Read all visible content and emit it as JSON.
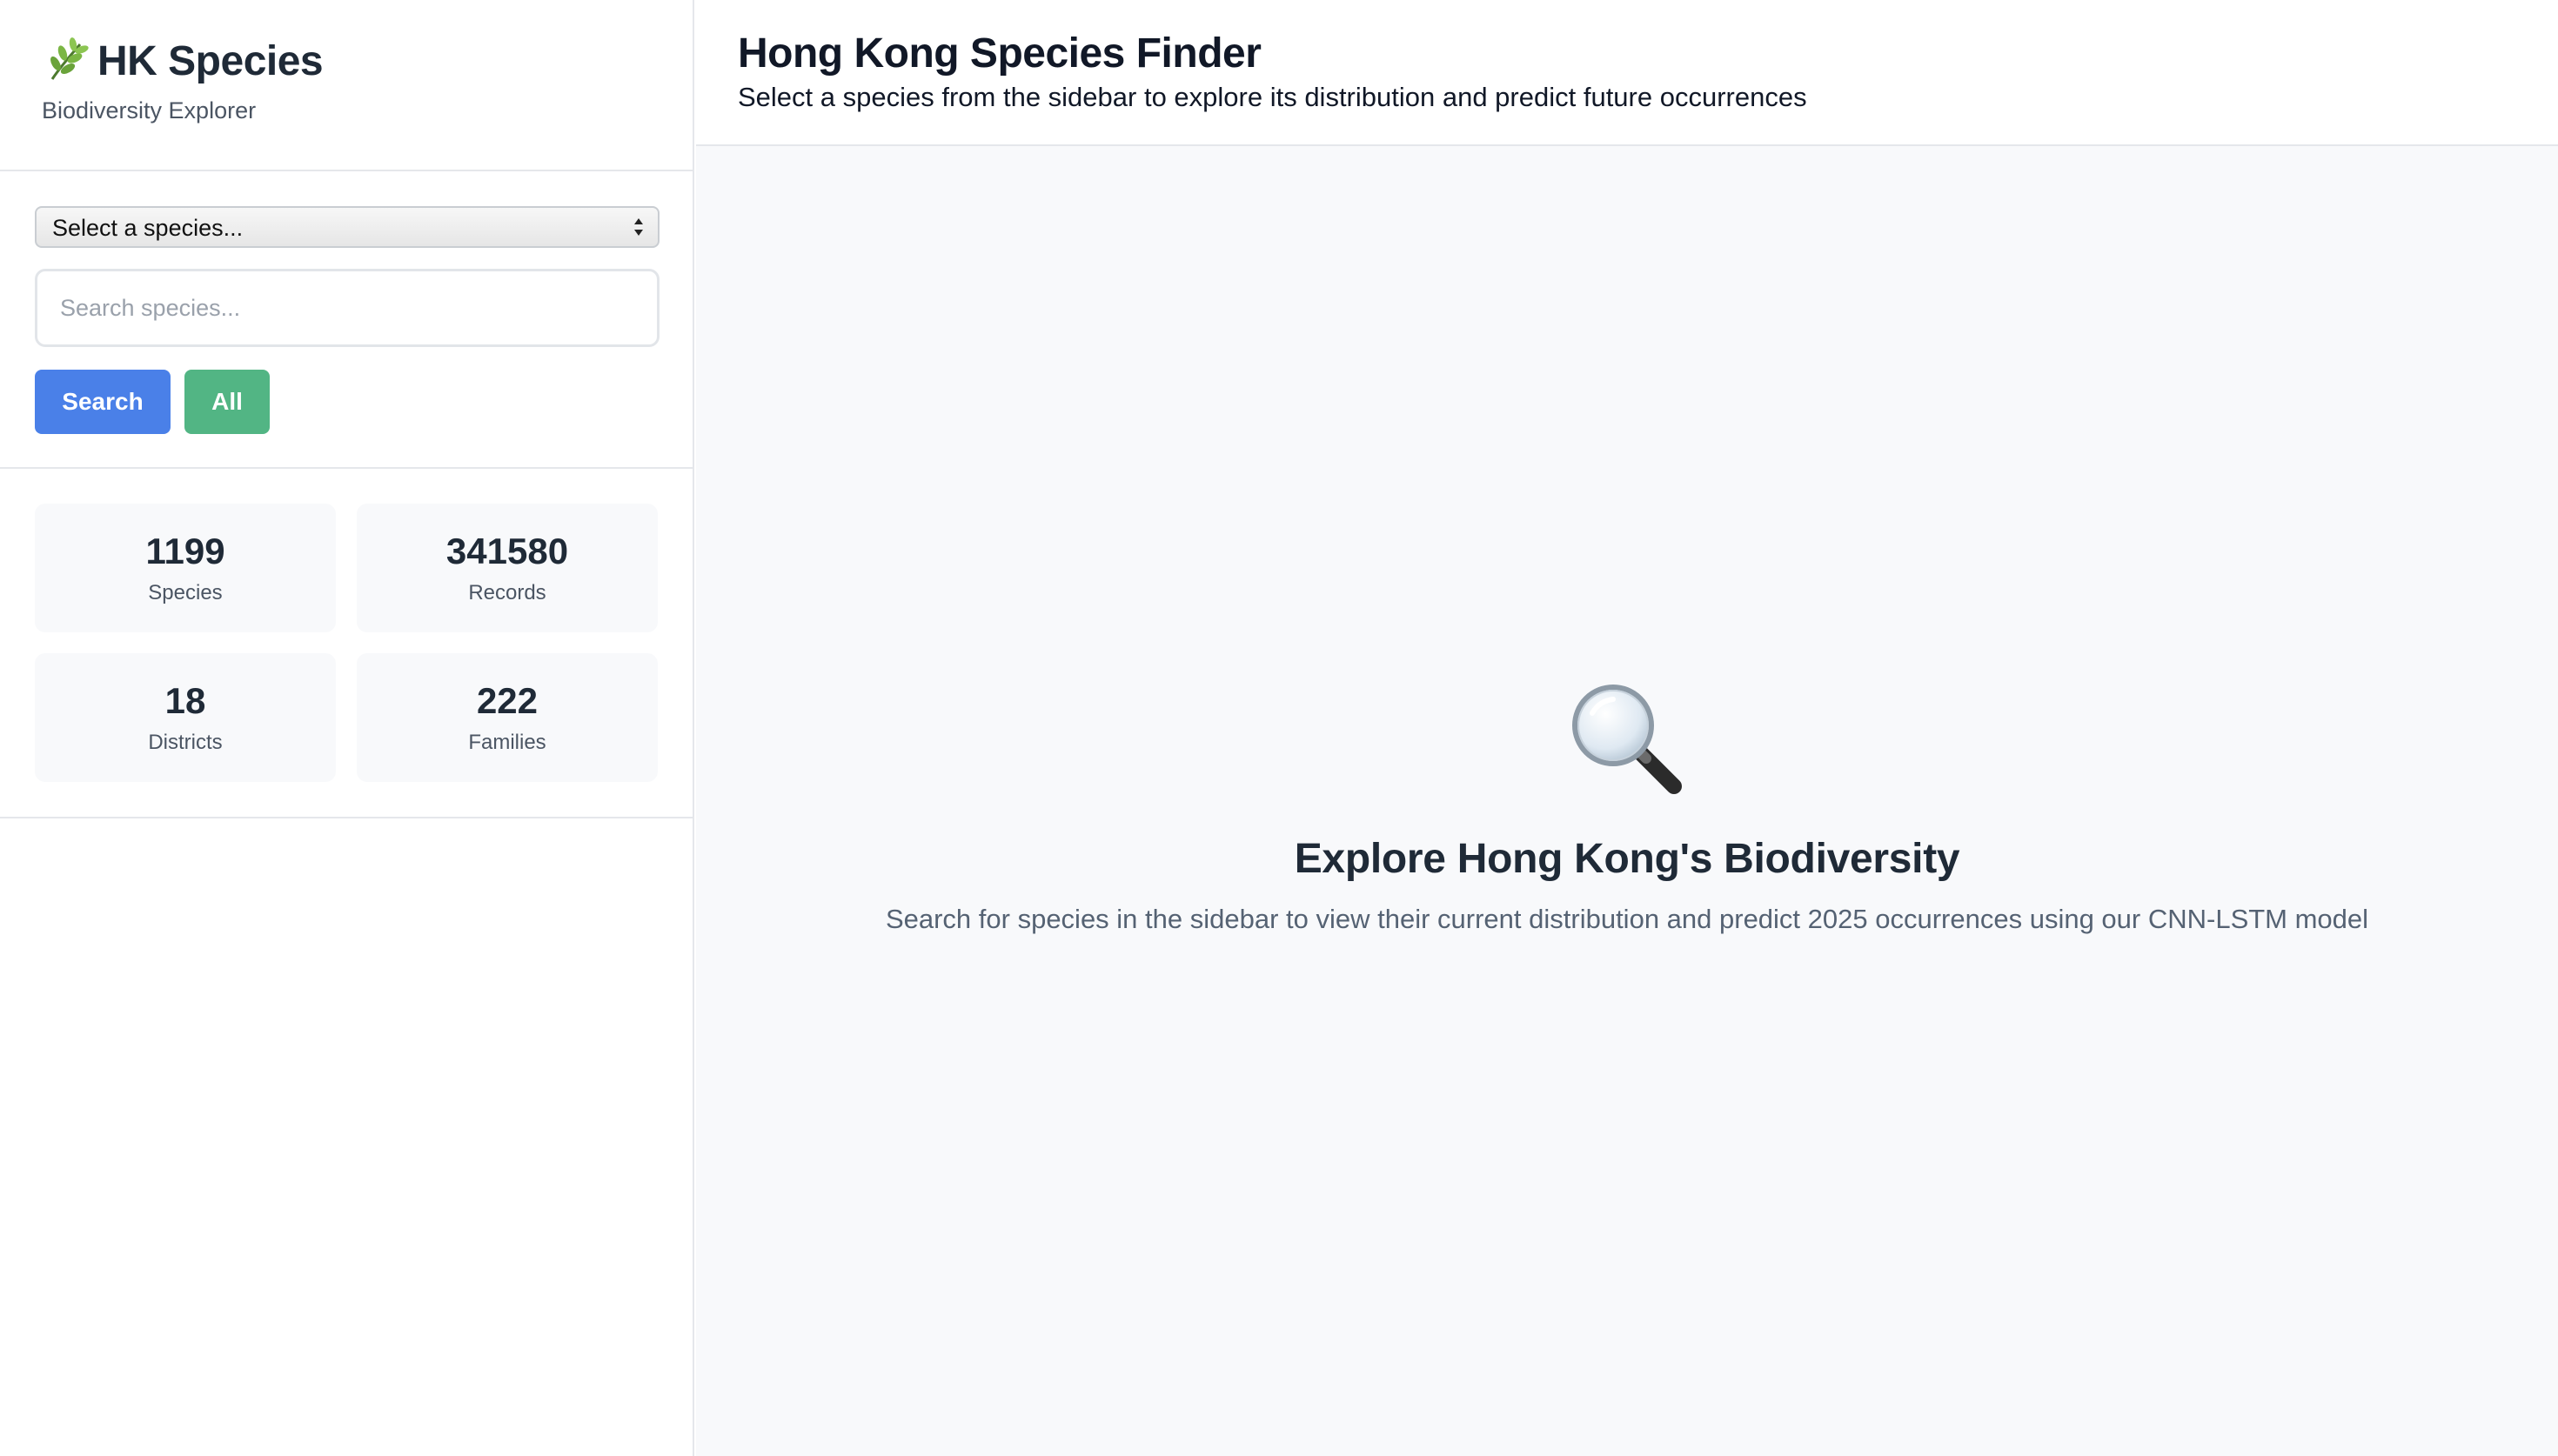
{
  "sidebar": {
    "brand": {
      "title": "HK Species",
      "subtitle": "Biodiversity Explorer",
      "icon": "leaf-icon"
    },
    "species_select": {
      "selected": "Select a species..."
    },
    "search": {
      "placeholder": "Search species...",
      "value": ""
    },
    "buttons": {
      "search_label": "Search",
      "all_label": "All"
    },
    "stats": [
      {
        "value": "1199",
        "label": "Species"
      },
      {
        "value": "341580",
        "label": "Records"
      },
      {
        "value": "18",
        "label": "Districts"
      },
      {
        "value": "222",
        "label": "Families"
      }
    ]
  },
  "header": {
    "title": "Hong Kong Species Finder",
    "subtitle": "Select a species from the sidebar to explore its distribution and predict future occurrences"
  },
  "empty_state": {
    "icon": "magnifier-icon",
    "title": "Explore Hong Kong's Biodiversity",
    "text": "Search for species in the sidebar to view their current distribution and predict 2025 occurrences using our CNN-LSTM model"
  },
  "colors": {
    "primary": "#4a80e8",
    "success": "#52b584",
    "background": "#f8f9fb",
    "border": "#e5e7eb"
  }
}
